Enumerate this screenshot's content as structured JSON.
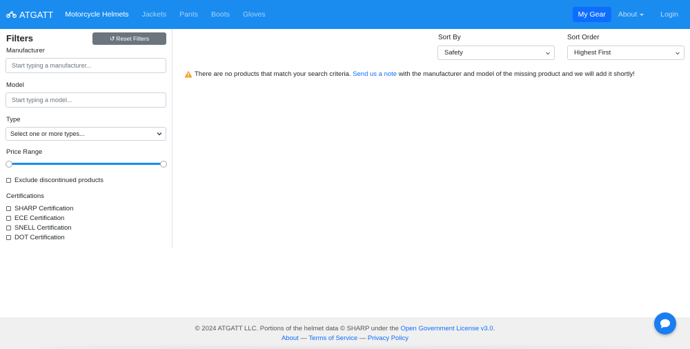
{
  "navbar": {
    "brand": "ATGATT",
    "links": [
      "Motorcycle Helmets",
      "Jackets",
      "Pants",
      "Boots",
      "Gloves"
    ],
    "my_gear": "My Gear",
    "about": "About",
    "login": "Login"
  },
  "sidebar": {
    "title": "Filters",
    "reset_label": "Reset Filters",
    "manufacturer_label": "Manufacturer",
    "manufacturer_placeholder": "Start typing a manufacturer...",
    "model_label": "Model",
    "model_placeholder": "Start typing a model...",
    "type_label": "Type",
    "type_value": "Select one or more types...",
    "price_label": "Price Range",
    "exclude_label": "Exclude discontinued products",
    "certifications_label": "Certifications",
    "certifications": [
      "SHARP Certification",
      "ECE Certification",
      "SNELL Certification",
      "DOT Certification"
    ]
  },
  "main": {
    "sort_by_label": "Sort By",
    "sort_by_value": "Safety",
    "sort_order_label": "Sort Order",
    "sort_order_value": "Highest First",
    "notice_before": "There are no products that match your search criteria.",
    "notice_link": "Send us a note",
    "notice_after": "with the manufacturer and model of the missing product and we will add it shortly!"
  },
  "footer": {
    "copyright": "© 2024 ATGATT LLC. Portions of the helmet data © SHARP under the",
    "license_link": "Open Government License v3.0",
    "license_end": ".",
    "about_link": "About",
    "sep": "—",
    "terms_link": "Terms of Service",
    "privacy_link": "Privacy Policy"
  },
  "colors": {
    "navbar": "#1a8cf0",
    "my_gear": "#0d6efd",
    "link": "#0d6efd",
    "warning": "#f0a020"
  }
}
